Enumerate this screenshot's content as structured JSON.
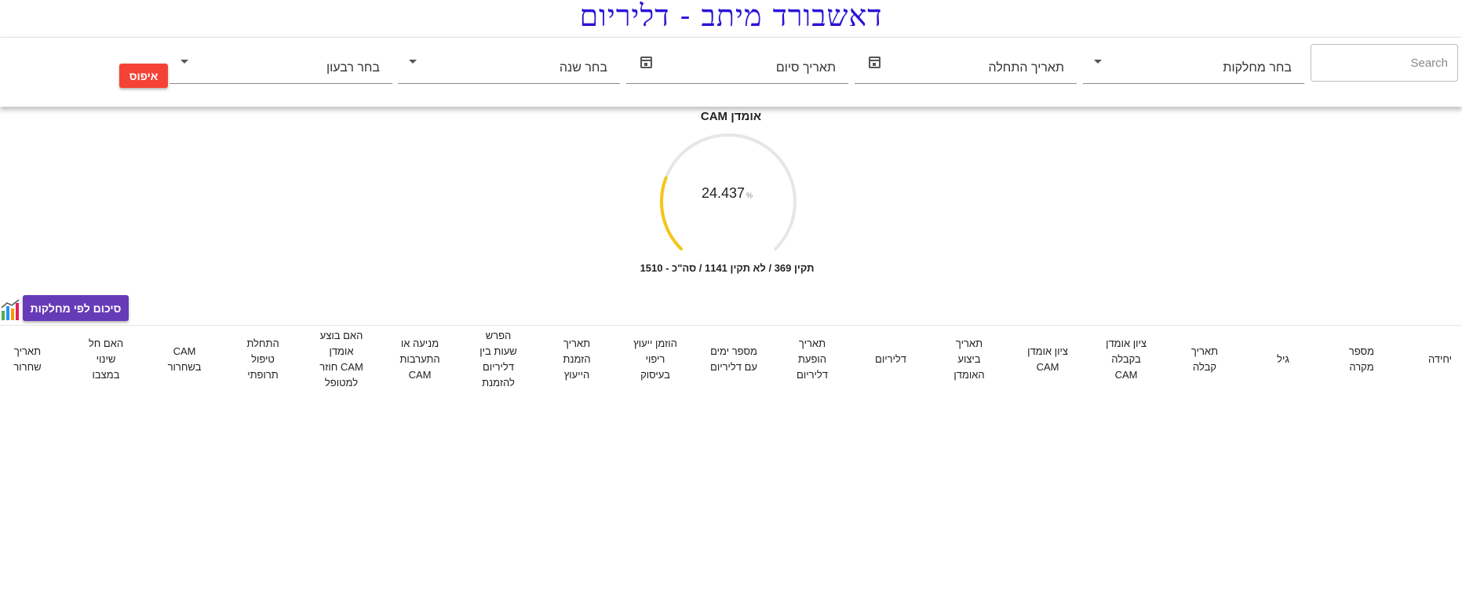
{
  "page_title": "דאשבורד מיתב - דליריום",
  "filters": {
    "search_placeholder": "Search",
    "department": "בחר מחלקות",
    "start_date": "תאריך התחלה",
    "end_date": "תאריך סיום",
    "year": "בחר שנה",
    "quarter": "בחר רבעון",
    "reset_label": "איפוס"
  },
  "gauge": {
    "title": "CAM אומדן",
    "value": "24.437",
    "unit": "%",
    "fraction": 0.24437,
    "colors": {
      "track": "#e6e6e6",
      "fill": "#f5c518"
    },
    "summary": "תקין 369 / לא תקין 1141 / סה\"כ - 1510"
  },
  "summary_button_label": "סיכום לפי מחלקות",
  "table": {
    "columns": [
      "יחידה",
      "מספר\nמקרה",
      "גיל",
      "תאריך\nקבלה",
      "ציון אומדן\nבקבלה\nCAM",
      "ציון אומדן\nCAM",
      "תאריך\nביצוע\nהאומדן",
      "דליריום",
      "תאריך\nהופעת\nדליריום",
      "מספר ימים\nעם דליריום",
      "הוזמן ייעוץ\nריפוי\nבעיסוק",
      "תאריך\nהזמנת\nהייעוץ",
      "הפרש\nשעות בין\nדליריום\nלהזמנת",
      "מניעה או\nהתערבות\nCAM",
      "האם בוצע\nאומדן\nCAM חוזר\nלמטופל",
      "התחלת\nטיפול\nתרופתי",
      "CAM\nבשחרור",
      "האם חל\nשינוי\nבמצבו",
      "תאריך\nשחרור"
    ]
  }
}
